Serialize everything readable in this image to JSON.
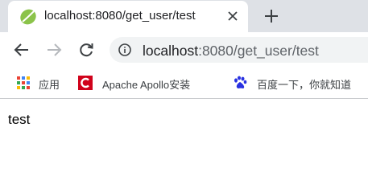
{
  "tab": {
    "title": "localhost:8080/get_user/test",
    "favicon": "spring-leaf-icon"
  },
  "toolbar": {
    "url_host": "localhost",
    "url_rest": ":8080/get_user/test"
  },
  "bookmarks": [
    {
      "label": "应用",
      "icon": "apps-grid-icon"
    },
    {
      "label": "Apache Apollo安装",
      "icon": "apollo-c-icon"
    },
    {
      "label": "百度一下，你就知道",
      "icon": "baidu-paw-icon"
    }
  ],
  "page": {
    "body_text": "test"
  },
  "colors": {
    "tabstrip": "#dee1e6",
    "omnibox": "#f1f3f4",
    "spring_green": "#6db33f",
    "apollo_red": "#d0021b",
    "baidu_blue": "#2932e1"
  }
}
